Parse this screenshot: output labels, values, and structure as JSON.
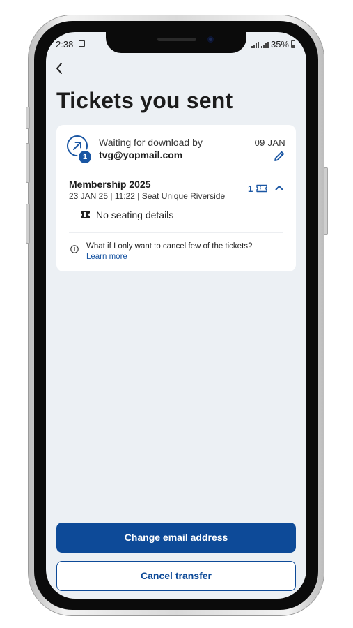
{
  "status_bar": {
    "time": "2:38",
    "battery": "35%",
    "icons": [
      "gallery-icon",
      "signal-icon",
      "signal-icon",
      "battery-icon"
    ]
  },
  "header": {
    "back_icon": "chevron-left-icon",
    "title": "Tickets you sent"
  },
  "transfer": {
    "icon": "arrow-up-right-icon",
    "badge_count": "1",
    "waiting_label": "Waiting for download by",
    "recipient_email": "tvg@yopmail.com",
    "date": "09 JAN",
    "edit_icon": "pencil-icon",
    "membership": {
      "title": "Membership 2025",
      "meta": "23 JAN 25 | 11:22 | Seat Unique Riverside",
      "ticket_count": "1",
      "ticket_icon": "ticket-icon",
      "expand_icon": "chevron-up-icon"
    },
    "seating": {
      "icon": "seat-icon",
      "text": "No seating details"
    },
    "help": {
      "icon": "info-icon",
      "question": "What if I only want to cancel few of the tickets?",
      "link": "Learn more"
    }
  },
  "actions": {
    "primary": "Change email address",
    "secondary": "Cancel transfer"
  },
  "colors": {
    "accent": "#0d4a98",
    "link": "#1a56a3",
    "screen_background": "#ecf0f4",
    "card_background": "#ffffff"
  }
}
